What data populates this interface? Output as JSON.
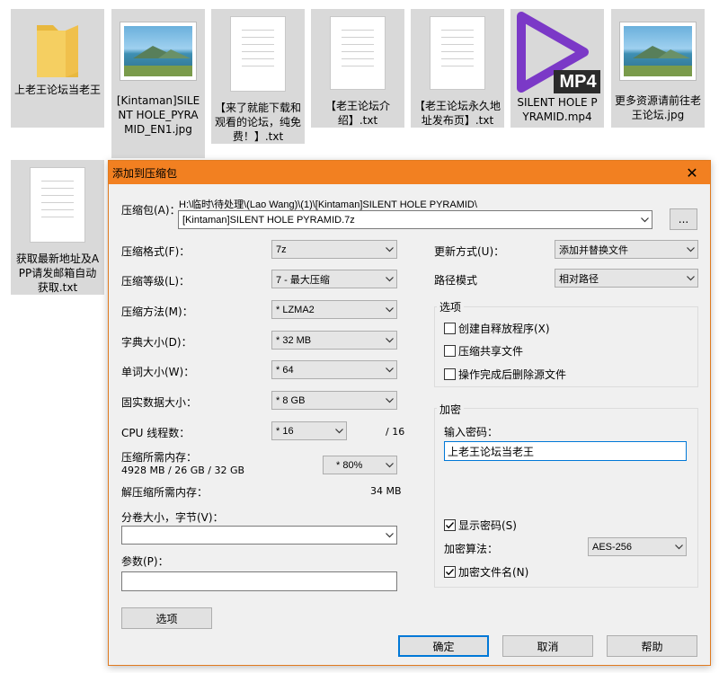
{
  "files": [
    {
      "name": "上老王论坛当老王",
      "kind": "folder",
      "icon": "folder-icon"
    },
    {
      "name": "[Kintaman]SILENT HOLE_PYRAMID_EN1.jpg",
      "kind": "image",
      "icon": "image-icon"
    },
    {
      "name": "【来了就能下载和观看的论坛，纯免费！】.txt",
      "kind": "text",
      "icon": "text-file-icon"
    },
    {
      "name": "【老王论坛介绍】.txt",
      "kind": "text",
      "icon": "text-file-icon"
    },
    {
      "name": "【老王论坛永久地址发布页】.txt",
      "kind": "text",
      "icon": "text-file-icon"
    },
    {
      "name": "SILENT HOLE PYRAMID.mp4",
      "kind": "video",
      "icon": "video-file-icon",
      "badge": "MP4"
    },
    {
      "name": "更多资源请前往老王论坛.jpg",
      "kind": "image",
      "icon": "image-icon"
    },
    {
      "name": "获取最新地址及APP请发邮箱自动获取.txt",
      "kind": "text",
      "icon": "text-file-icon"
    }
  ],
  "dialog": {
    "title": "添加到压缩包",
    "close_glyph": "✕",
    "archive": {
      "label": "压缩包(A)：",
      "path": "H:\\临时\\待处理\\(Lao Wang)\\(1)\\[Kintaman]SILENT HOLE PYRAMID\\",
      "name": "[Kintaman]SILENT HOLE PYRAMID.7z",
      "browse": "..."
    },
    "left": {
      "format": {
        "label": "压缩格式(F)：",
        "value": "7z"
      },
      "level": {
        "label": "压缩等级(L)：",
        "value": "7 - 最大压缩"
      },
      "method": {
        "label": "压缩方法(M)：",
        "value": "* LZMA2"
      },
      "dict": {
        "label": "字典大小(D)：",
        "value": "* 32 MB"
      },
      "word": {
        "label": "单词大小(W)：",
        "value": "* 64"
      },
      "solid": {
        "label": "固实数据大小：",
        "value": "* 8 GB"
      },
      "cpu": {
        "label": "CPU 线程数：",
        "value": "* 16",
        "total": "/ 16"
      },
      "mem_compress": {
        "label": "压缩所需内存：",
        "detail": "4928 MB / 26 GB / 32 GB",
        "value": "* 80%"
      },
      "mem_decompress": {
        "label": "解压缩所需内存：",
        "value": "34 MB"
      },
      "split": {
        "label": "分卷大小，字节(V)：",
        "value": ""
      },
      "params": {
        "label": "参数(P)：",
        "value": ""
      },
      "options_button": "选项"
    },
    "right": {
      "update": {
        "label": "更新方式(U)：",
        "value": "添加并替换文件"
      },
      "path_mode": {
        "label": "路径模式",
        "value": "相对路径"
      },
      "options_group": {
        "title": "选项",
        "items": [
          {
            "label": "创建自释放程序(X)",
            "checked": false
          },
          {
            "label": "压缩共享文件",
            "checked": false
          },
          {
            "label": "操作完成后删除源文件",
            "checked": false
          }
        ]
      },
      "encryption": {
        "title": "加密",
        "password_label": "输入密码：",
        "password_value": "上老王论坛当老王",
        "show_password": {
          "label": "显示密码(S)",
          "checked": true
        },
        "method_label": "加密算法：",
        "method_value": "AES-256",
        "encrypt_names": {
          "label": "加密文件名(N)",
          "checked": true
        }
      }
    },
    "buttons": {
      "ok": "确定",
      "cancel": "取消",
      "help": "帮助"
    }
  },
  "colors": {
    "titlebar": "#f28021",
    "accent": "#0078d7",
    "tile": "#d9d9d9"
  }
}
